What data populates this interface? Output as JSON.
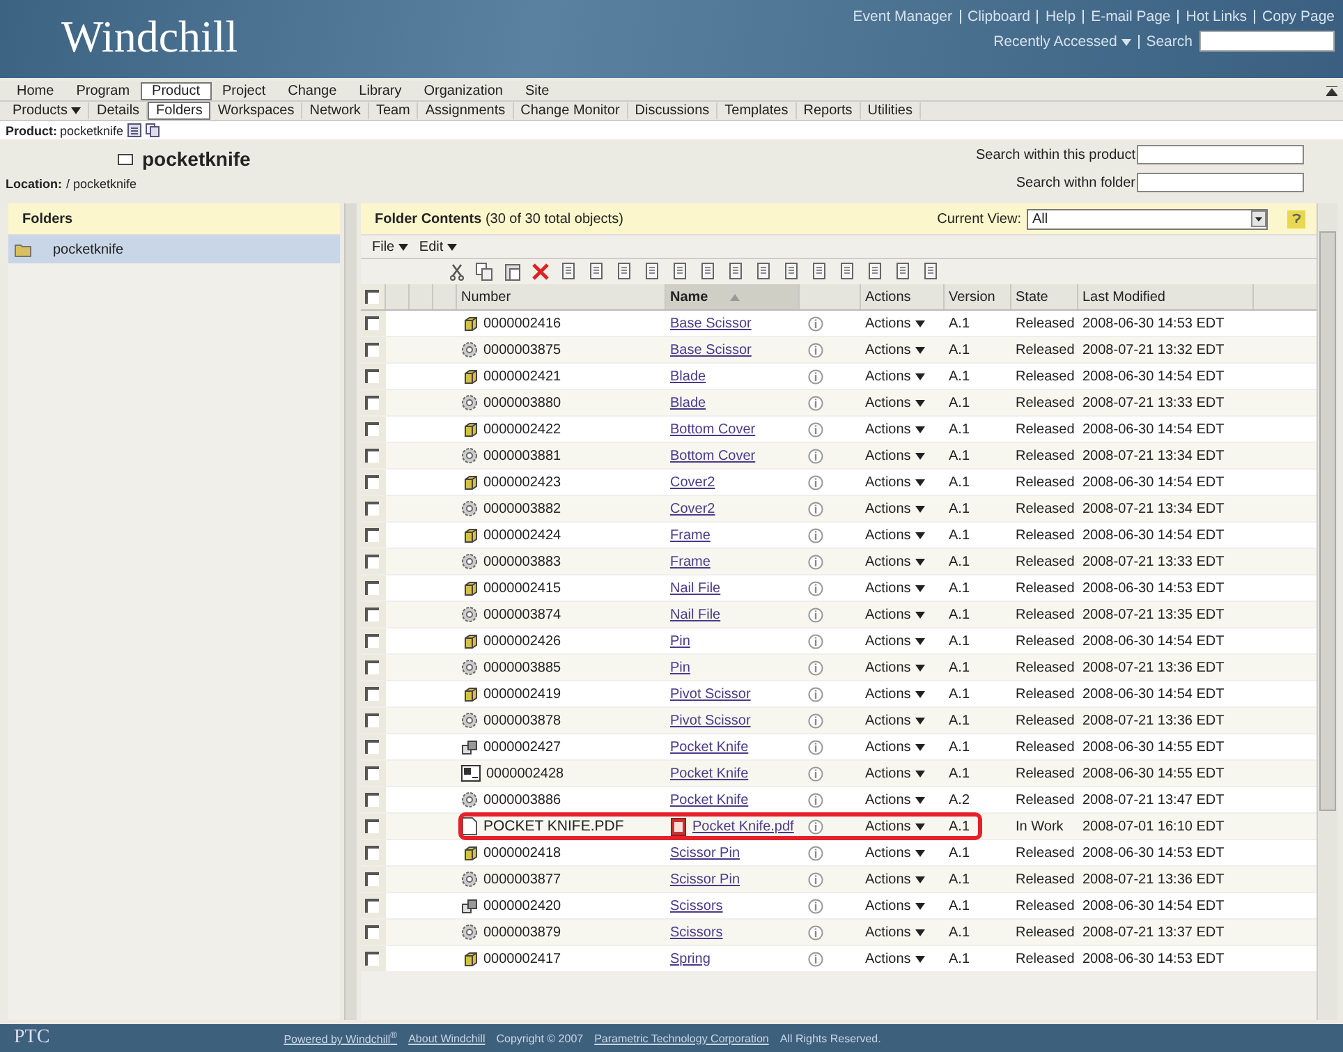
{
  "header": {
    "logo": "Windchill",
    "links": [
      "Event Manager",
      "Clipboard",
      "Help",
      "E-mail Page",
      "Hot Links",
      "Copy Page"
    ],
    "recently_accessed": "Recently Accessed",
    "search_label": "Search"
  },
  "nav_primary": [
    {
      "label": "Home",
      "selected": false
    },
    {
      "label": "Program",
      "selected": false
    },
    {
      "label": "Product",
      "selected": true
    },
    {
      "label": "Project",
      "selected": false
    },
    {
      "label": "Change",
      "selected": false
    },
    {
      "label": "Library",
      "selected": false
    },
    {
      "label": "Organization",
      "selected": false
    },
    {
      "label": "Site",
      "selected": false
    }
  ],
  "nav_secondary": [
    {
      "label": "Products",
      "selected": false,
      "dropdown": true
    },
    {
      "label": "Details",
      "selected": false,
      "dropdown": false
    },
    {
      "label": "Folders",
      "selected": true,
      "dropdown": false
    },
    {
      "label": "Workspaces",
      "selected": false,
      "dropdown": false
    },
    {
      "label": "Network",
      "selected": false,
      "dropdown": false
    },
    {
      "label": "Team",
      "selected": false,
      "dropdown": false
    },
    {
      "label": "Assignments",
      "selected": false,
      "dropdown": false
    },
    {
      "label": "Change Monitor",
      "selected": false,
      "dropdown": false
    },
    {
      "label": "Discussions",
      "selected": false,
      "dropdown": false
    },
    {
      "label": "Templates",
      "selected": false,
      "dropdown": false
    },
    {
      "label": "Reports",
      "selected": false,
      "dropdown": false
    },
    {
      "label": "Utilities",
      "selected": false,
      "dropdown": false
    }
  ],
  "product_line": {
    "label": "Product:",
    "value": "pocketknife"
  },
  "title": "pocketknife",
  "location": {
    "label": "Location:",
    "value": "/ pocketknife"
  },
  "search_fields": [
    {
      "label": "Search within this product"
    },
    {
      "label": "Search withn folder"
    }
  ],
  "folders": {
    "title": "Folders",
    "items": [
      {
        "label": "pocketknife",
        "selected": true
      }
    ]
  },
  "contents": {
    "select_all_checked": false,
    "title": "Folder Contents",
    "count": "(30 of 30 total objects)",
    "view_label": "Current View:",
    "view_value": "All",
    "menus": [
      "File",
      "Edit"
    ],
    "columns": [
      {
        "label": "Number",
        "sorted": false
      },
      {
        "label": "Name",
        "sorted": true
      },
      {
        "label": "Actions",
        "sorted": false
      },
      {
        "label": "Version",
        "sorted": false
      },
      {
        "label": "State",
        "sorted": false
      },
      {
        "label": "Last Modified",
        "sorted": false
      }
    ],
    "rows": [
      {
        "kind": "part",
        "number": "0000002416",
        "name": "Base Scissor",
        "actions": "Actions",
        "version": "A.1",
        "state": "Released",
        "modified": "2008-06-30 14:53 EDT",
        "checked": false,
        "highlighted": false
      },
      {
        "kind": "cad",
        "number": "0000003875",
        "name": "Base Scissor",
        "actions": "Actions",
        "version": "A.1",
        "state": "Released",
        "modified": "2008-07-21 13:32 EDT",
        "checked": false,
        "highlighted": false
      },
      {
        "kind": "part",
        "number": "0000002421",
        "name": "Blade",
        "actions": "Actions",
        "version": "A.1",
        "state": "Released",
        "modified": "2008-06-30 14:54 EDT",
        "checked": false,
        "highlighted": false
      },
      {
        "kind": "cad",
        "number": "0000003880",
        "name": "Blade",
        "actions": "Actions",
        "version": "A.1",
        "state": "Released",
        "modified": "2008-07-21 13:33 EDT",
        "checked": false,
        "highlighted": false
      },
      {
        "kind": "part",
        "number": "0000002422",
        "name": "Bottom Cover",
        "actions": "Actions",
        "version": "A.1",
        "state": "Released",
        "modified": "2008-06-30 14:54 EDT",
        "checked": false,
        "highlighted": false
      },
      {
        "kind": "cad",
        "number": "0000003881",
        "name": "Bottom Cover",
        "actions": "Actions",
        "version": "A.1",
        "state": "Released",
        "modified": "2008-07-21 13:34 EDT",
        "checked": false,
        "highlighted": false
      },
      {
        "kind": "part",
        "number": "0000002423",
        "name": "Cover2",
        "actions": "Actions",
        "version": "A.1",
        "state": "Released",
        "modified": "2008-06-30 14:54 EDT",
        "checked": false,
        "highlighted": false
      },
      {
        "kind": "cad",
        "number": "0000003882",
        "name": "Cover2",
        "actions": "Actions",
        "version": "A.1",
        "state": "Released",
        "modified": "2008-07-21 13:34 EDT",
        "checked": false,
        "highlighted": false
      },
      {
        "kind": "part",
        "number": "0000002424",
        "name": "Frame",
        "actions": "Actions",
        "version": "A.1",
        "state": "Released",
        "modified": "2008-06-30 14:54 EDT",
        "checked": false,
        "highlighted": false
      },
      {
        "kind": "cad",
        "number": "0000003883",
        "name": "Frame",
        "actions": "Actions",
        "version": "A.1",
        "state": "Released",
        "modified": "2008-07-21 13:33 EDT",
        "checked": false,
        "highlighted": false
      },
      {
        "kind": "part",
        "number": "0000002415",
        "name": "Nail File",
        "actions": "Actions",
        "version": "A.1",
        "state": "Released",
        "modified": "2008-06-30 14:53 EDT",
        "checked": false,
        "highlighted": false
      },
      {
        "kind": "cad",
        "number": "0000003874",
        "name": "Nail File",
        "actions": "Actions",
        "version": "A.1",
        "state": "Released",
        "modified": "2008-07-21 13:35 EDT",
        "checked": false,
        "highlighted": false
      },
      {
        "kind": "part",
        "number": "0000002426",
        "name": "Pin",
        "actions": "Actions",
        "version": "A.1",
        "state": "Released",
        "modified": "2008-06-30 14:54 EDT",
        "checked": false,
        "highlighted": false
      },
      {
        "kind": "cad",
        "number": "0000003885",
        "name": "Pin",
        "actions": "Actions",
        "version": "A.1",
        "state": "Released",
        "modified": "2008-07-21 13:36 EDT",
        "checked": false,
        "highlighted": false
      },
      {
        "kind": "part",
        "number": "0000002419",
        "name": "Pivot Scissor",
        "actions": "Actions",
        "version": "A.1",
        "state": "Released",
        "modified": "2008-06-30 14:54 EDT",
        "checked": false,
        "highlighted": false
      },
      {
        "kind": "cad",
        "number": "0000003878",
        "name": "Pivot Scissor",
        "actions": "Actions",
        "version": "A.1",
        "state": "Released",
        "modified": "2008-07-21 13:36 EDT",
        "checked": false,
        "highlighted": false
      },
      {
        "kind": "assembly",
        "number": "0000002427",
        "name": "Pocket Knife",
        "actions": "Actions",
        "version": "A.1",
        "state": "Released",
        "modified": "2008-06-30 14:55 EDT",
        "checked": false,
        "highlighted": false
      },
      {
        "kind": "drawing",
        "number": "0000002428",
        "name": "Pocket Knife",
        "actions": "Actions",
        "version": "A.1",
        "state": "Released",
        "modified": "2008-06-30 14:55 EDT",
        "checked": false,
        "highlighted": false
      },
      {
        "kind": "cad",
        "number": "0000003886",
        "name": "Pocket Knife",
        "actions": "Actions",
        "version": "A.2",
        "state": "Released",
        "modified": "2008-07-21 13:47 EDT",
        "checked": false,
        "highlighted": false
      },
      {
        "kind": "document",
        "number": "POCKET KNIFE.PDF",
        "name": "Pocket Knife.pdf",
        "actions": "Actions",
        "version": "A.1",
        "state": "In Work",
        "modified": "2008-07-01 16:10 EDT",
        "checked": false,
        "highlighted": true
      },
      {
        "kind": "part",
        "number": "0000002418",
        "name": "Scissor Pin",
        "actions": "Actions",
        "version": "A.1",
        "state": "Released",
        "modified": "2008-06-30 14:53 EDT",
        "checked": false,
        "highlighted": false
      },
      {
        "kind": "cad",
        "number": "0000003877",
        "name": "Scissor Pin",
        "actions": "Actions",
        "version": "A.1",
        "state": "Released",
        "modified": "2008-07-21 13:36 EDT",
        "checked": false,
        "highlighted": false
      },
      {
        "kind": "assembly",
        "number": "0000002420",
        "name": "Scissors",
        "actions": "Actions",
        "version": "A.1",
        "state": "Released",
        "modified": "2008-06-30 14:54 EDT",
        "checked": false,
        "highlighted": false
      },
      {
        "kind": "cad",
        "number": "0000003879",
        "name": "Scissors",
        "actions": "Actions",
        "version": "A.1",
        "state": "Released",
        "modified": "2008-07-21 13:37 EDT",
        "checked": false,
        "highlighted": false
      },
      {
        "kind": "part",
        "number": "0000002417",
        "name": "Spring",
        "actions": "Actions",
        "version": "A.1",
        "state": "Released",
        "modified": "2008-06-30 14:53 EDT",
        "checked": false,
        "highlighted": false
      }
    ]
  },
  "footer": {
    "logo": "PTC",
    "links": [
      {
        "kind": "link",
        "text": "Powered by Windchill$^{®}$"
      },
      {
        "kind": "link",
        "text": "About Windchill"
      },
      {
        "kind": "text",
        "text": "Copyright © 2007"
      },
      {
        "kind": "link",
        "text": "Parametric Technology Corporation"
      },
      {
        "kind": "text",
        "text": "All Rights Reserved."
      }
    ]
  }
}
